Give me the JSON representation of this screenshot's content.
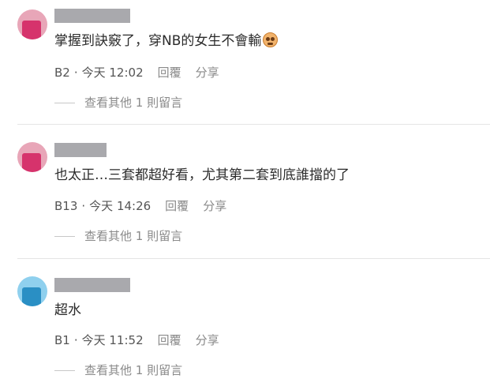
{
  "comments": [
    {
      "avatar_color": "#e8a6b8",
      "avatar_fg": "#d6336c",
      "text": "掌握到訣竅了，穿NB的女生不會輸",
      "floor": "B2",
      "separator": "·",
      "time": "今天 12:02",
      "reply_label": "回覆",
      "share_label": "分享",
      "more_replies": "查看其他 1 則留言"
    },
    {
      "avatar_color": "#e8a6b8",
      "avatar_fg": "#d6336c",
      "text": "也太正…三套都超好看，尤其第二套到底誰擋的了",
      "floor": "B13",
      "separator": "·",
      "time": "今天 14:26",
      "reply_label": "回覆",
      "share_label": "分享",
      "more_replies": "查看其他 1 則留言"
    },
    {
      "avatar_color": "#8fd0ee",
      "avatar_fg": "#2a8fc4",
      "text": "超水",
      "floor": "B1",
      "separator": "·",
      "time": "今天 11:52",
      "reply_label": "回覆",
      "share_label": "分享",
      "more_replies": "查看其他 1 則留言"
    }
  ],
  "emoji_icon": "grinning-face-emoji-icon"
}
